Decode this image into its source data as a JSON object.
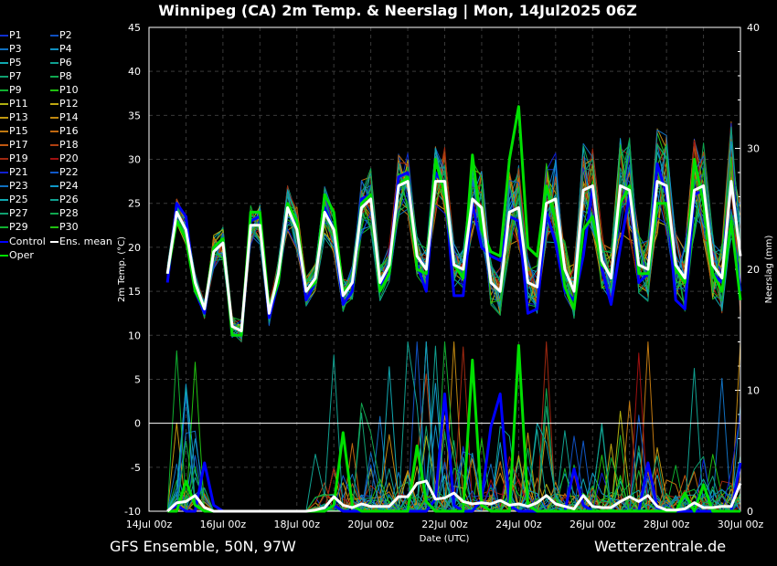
{
  "title": "Winnipeg  (CA)  2m Temp. & Neerslag | Mon, 14Jul2025 06Z",
  "footer_left": "GFS Ensemble, 50N, 97W",
  "footer_right": "Wetterzentrale.de",
  "legend": [
    {
      "label": "P1",
      "color": "#1030d0"
    },
    {
      "label": "P2",
      "color": "#1050c0"
    },
    {
      "label": "P3",
      "color": "#1070c0"
    },
    {
      "label": "P4",
      "color": "#1090c0"
    },
    {
      "label": "P5",
      "color": "#10a8b0"
    },
    {
      "label": "P6",
      "color": "#10a090"
    },
    {
      "label": "P7",
      "color": "#10a070"
    },
    {
      "label": "P8",
      "color": "#10a850"
    },
    {
      "label": "P9",
      "color": "#10b030"
    },
    {
      "label": "P10",
      "color": "#20c010"
    },
    {
      "label": "P11",
      "color": "#b0b010"
    },
    {
      "label": "P12",
      "color": "#c0a810"
    },
    {
      "label": "P13",
      "color": "#c09810"
    },
    {
      "label": "P14",
      "color": "#c08810"
    },
    {
      "label": "P15",
      "color": "#c07810"
    },
    {
      "label": "P16",
      "color": "#c06810"
    },
    {
      "label": "P17",
      "color": "#c05810"
    },
    {
      "label": "P18",
      "color": "#b04010"
    },
    {
      "label": "P19",
      "color": "#a02810"
    },
    {
      "label": "P20",
      "color": "#a01010"
    },
    {
      "label": "P21",
      "color": "#1020d0"
    },
    {
      "label": "P22",
      "color": "#1058c8"
    },
    {
      "label": "P23",
      "color": "#1070c0"
    },
    {
      "label": "P24",
      "color": "#1098c8"
    },
    {
      "label": "P25",
      "color": "#10a8b0"
    },
    {
      "label": "P26",
      "color": "#10a090"
    },
    {
      "label": "P27",
      "color": "#10a070"
    },
    {
      "label": "P28",
      "color": "#10a850"
    },
    {
      "label": "P29",
      "color": "#10b030"
    },
    {
      "label": "P30",
      "color": "#20c010"
    },
    {
      "label": "Control",
      "color": "#0000ff"
    },
    {
      "label": "Ens. mean",
      "color": "#ffffff"
    },
    {
      "label": "Oper",
      "color": "#00e000"
    }
  ],
  "chart_data": {
    "type": "line",
    "title": "Winnipeg  (CA)  2m Temp. & Neerslag | Mon, 14Jul2025 06Z",
    "xlabel": "Date (UTC)",
    "ylabel": "2m Temp. (°C)",
    "y2label": "Neerslag (mm)",
    "ylim": [
      -10,
      45
    ],
    "y2lim": [
      0,
      40
    ],
    "xlim_hours": [
      0,
      384
    ],
    "x_start": "14Jul 00z",
    "yticks": [
      "45",
      "40",
      "35",
      "30",
      "25",
      "20",
      "15",
      "10",
      "5",
      "0",
      "-5",
      "-10"
    ],
    "y2ticks": [
      "40",
      "30",
      "20",
      "10",
      "0"
    ],
    "xticks": [
      "14Jul 00z",
      "16Jul 00z",
      "18Jul 00z",
      "20Jul 00z",
      "22Jul 00z",
      "24Jul 00z",
      "26Jul 00z",
      "28Jul 00z",
      "30Jul 00z"
    ],
    "grid": true,
    "legend_position": "left-outside",
    "x_hours_start": 12,
    "x_hours_step": 6,
    "temperature": {
      "ens_mean": [
        17,
        24,
        22,
        16,
        13,
        19.5,
        20.5,
        11,
        10.5,
        22.5,
        22.5,
        12.5,
        17,
        24.5,
        22,
        15,
        16.5,
        24,
        22,
        14.5,
        16,
        24.5,
        25.5,
        16,
        18,
        27,
        27.5,
        19,
        17.5,
        27.5,
        27.5,
        18,
        17.5,
        25.5,
        24.5,
        16,
        15,
        24,
        24.5,
        16,
        15.5,
        25,
        25.5,
        17.5,
        15,
        26.5,
        27,
        18.5,
        16.5,
        27,
        26.5,
        18,
        17.5,
        27.5,
        27,
        18,
        16.5,
        26.5,
        27,
        18,
        16.5,
        27.5,
        19
      ],
      "control": [
        16,
        25,
        23.5,
        15,
        12.5,
        20,
        21,
        10,
        10,
        23,
        23.5,
        12,
        16,
        24.5,
        22.5,
        14,
        16,
        24.5,
        22,
        13.5,
        15,
        25.5,
        26,
        15.5,
        18,
        28,
        28.5,
        18,
        15,
        28.5,
        27,
        14.5,
        14.5,
        25,
        20,
        19,
        18.5,
        23.5,
        23,
        12.5,
        13,
        24,
        20.5,
        15,
        14,
        19,
        27,
        17.5,
        13.5,
        20,
        26,
        16,
        17,
        29.5,
        26,
        14,
        13,
        26,
        26.5,
        17,
        16,
        23,
        15
      ],
      "oper": [
        17,
        23,
        21,
        15,
        13,
        20,
        21,
        10,
        10,
        24,
        24,
        13,
        16,
        25,
        23,
        15,
        16,
        26,
        24,
        15,
        16,
        25,
        26,
        15,
        17,
        27,
        28,
        17.5,
        17,
        30,
        26,
        18,
        16.5,
        30.5,
        22,
        19.5,
        19,
        30,
        36,
        20,
        19,
        27,
        23,
        15.5,
        13,
        22,
        23.5,
        18,
        17,
        25,
        27,
        17,
        17,
        25,
        25,
        17.5,
        16,
        30,
        25,
        17,
        15,
        23,
        14
      ],
      "member_spread_start": 1.5,
      "member_spread_end": 7
    },
    "precipitation": {
      "ens_mean": [
        0,
        0.7,
        0.8,
        1.3,
        0.3,
        0,
        0,
        0,
        0,
        0,
        0,
        0,
        0,
        0,
        0,
        0,
        0.1,
        0.3,
        1.2,
        0.5,
        0.3,
        0.6,
        0.4,
        0.4,
        0.4,
        1.2,
        1.2,
        2.3,
        2.5,
        1,
        1.1,
        1.5,
        0.8,
        0.6,
        0.7,
        0.6,
        0.9,
        0.5,
        0.6,
        0.4,
        0.7,
        1.3,
        0.6,
        0.4,
        0.2,
        1.3,
        0.4,
        0.3,
        0.3,
        0.8,
        1.2,
        0.8,
        1.3,
        0.4,
        0.1,
        0.1,
        0.2,
        0.7,
        0.3,
        0.3,
        0.4,
        0.4,
        2.3
      ],
      "control": [
        0,
        0.5,
        0,
        0,
        4,
        0.5,
        0,
        0,
        0,
        0,
        0,
        0,
        0,
        0,
        0,
        0,
        0,
        0,
        0.5,
        0,
        0,
        0,
        0,
        0,
        0,
        0,
        0,
        0,
        0,
        1,
        9.7,
        0.5,
        0,
        0,
        1,
        7,
        9.7,
        0.5,
        0,
        0,
        0,
        0,
        0,
        0,
        3.5,
        0.5,
        0,
        0,
        0,
        0,
        0,
        0,
        4,
        0.3,
        0,
        0,
        0,
        0,
        0,
        0,
        0,
        0,
        4
      ],
      "oper": [
        0,
        0,
        2.5,
        0.5,
        0,
        0,
        0,
        0,
        0,
        0,
        0,
        0,
        0,
        0,
        0,
        0,
        0,
        0,
        0.5,
        6.5,
        0.5,
        0,
        0,
        0,
        0,
        0,
        0,
        5.4,
        0.8,
        0,
        0,
        0,
        0,
        12.5,
        0.5,
        0,
        0,
        0,
        13.7,
        0.5,
        0,
        0,
        0,
        0,
        0,
        0,
        0,
        0,
        0,
        0,
        0,
        0,
        0,
        0,
        0,
        0,
        1.5,
        0,
        2.2,
        0,
        0,
        0,
        0
      ]
    }
  }
}
